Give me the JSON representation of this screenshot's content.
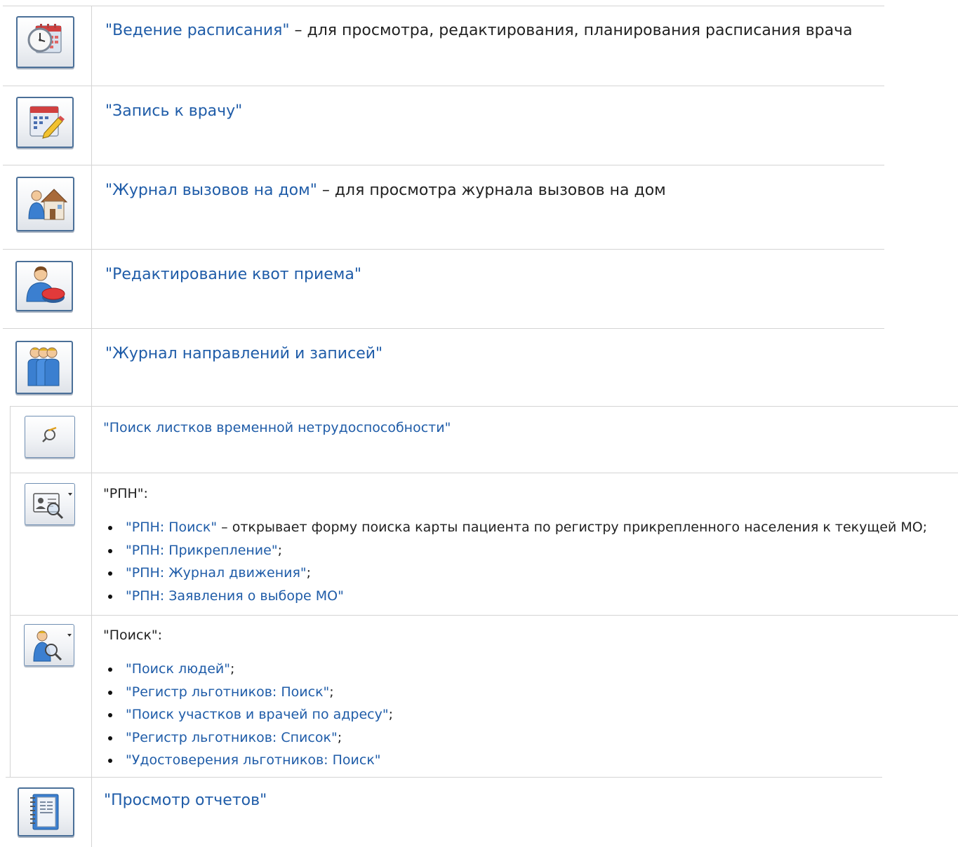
{
  "items": [
    {
      "link": "\"Ведение расписания\"",
      "desc": " – для просмотра, редактирования, планирования расписания врача",
      "icon": "schedule-clock-calendar-icon"
    },
    {
      "link": "\"Запись к врачу\"",
      "desc": "",
      "icon": "calendar-pencil-icon"
    },
    {
      "link": "\"Журнал вызовов на дом\"",
      "desc": " – для просмотра журнала вызовов на дом",
      "icon": "house-call-icon"
    },
    {
      "link": "\"Редактирование квот приема\"",
      "desc": "",
      "icon": "user-quota-icon"
    },
    {
      "link": "\"Журнал направлений и записей\"",
      "desc": "",
      "icon": "people-group-icon"
    },
    {
      "link": "\"Поиск листков временной нетрудоспособности\"",
      "desc": "",
      "icon": "sick-leave-search-icon"
    }
  ],
  "rpn": {
    "title": "\"РПН\":",
    "icon": "id-card-search-icon",
    "items": [
      {
        "link": "\"РПН: Поиск\"",
        "desc": " – открывает форму поиска карты пациента по регистру прикрепленного населения к текущей МО;"
      },
      {
        "link": "\"РПН: Прикрепление\"",
        "punct": ";"
      },
      {
        "link": "\"РПН: Журнал движения\"",
        "punct": ";"
      },
      {
        "link": "\"РПН: Заявления о выборе МО\"",
        "punct": ""
      }
    ]
  },
  "search": {
    "title": "\"Поиск\":",
    "icon": "person-search-icon",
    "items": [
      {
        "link": "\"Поиск людей\"",
        "punct": ";"
      },
      {
        "link": "\"Регистр льготников: Поиск\"",
        "punct": ";"
      },
      {
        "link": "\"Поиск участков и врачей по адресу\"",
        "punct": ";"
      },
      {
        "link": "\"Регистр льготников: Список\"",
        "punct": ";"
      },
      {
        "link": "\"Удостоверения льготников: Поиск\"",
        "punct": ""
      }
    ]
  },
  "reports": {
    "link": "\"Просмотр отчетов\"",
    "icon": "report-book-icon"
  }
}
